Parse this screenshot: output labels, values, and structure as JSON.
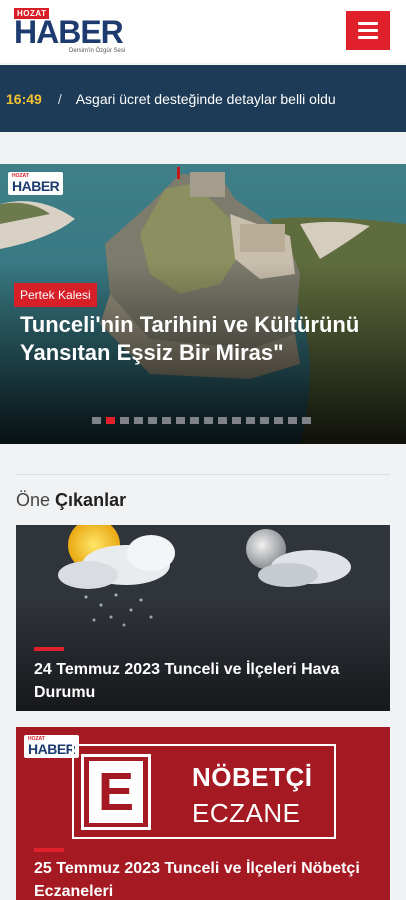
{
  "header": {
    "logo_top": "HOZAT",
    "logo_main": "HABER",
    "logo_slogan": "Dersim'in Özgür Sesi",
    "menu_icon": "hamburger-menu-icon"
  },
  "ticker": {
    "time": "16:49",
    "separator": "/",
    "headline": "Asgari ücret desteğinde detaylar belli oldu"
  },
  "slider": {
    "watermark_top": "HOZAT",
    "watermark_main": "HABER",
    "category": "Pertek Kalesi",
    "title": "Tunceli'nin Tarihini ve Kültürünü Yansıtan Eşsiz Bir Miras\"",
    "slide_count": 16,
    "active_slide": 2
  },
  "featured": {
    "section_title_light": "Öne",
    "section_title_bold": "Çıkanlar",
    "cards": [
      {
        "title": "24 Temmuz 2023 Tunceli ve İlçeleri Hava Durumu"
      },
      {
        "watermark_top": "HOZAT",
        "watermark_main": "HABER",
        "sign_letter": "E",
        "sign_line1": "NÖBETÇİ",
        "sign_line2": "ECZANE",
        "title": "25 Temmuz 2023 Tunceli ve İlçeleri Nöbetçi Eczaneleri"
      }
    ]
  },
  "colors": {
    "brand_red": "#e0202a",
    "brand_navy": "#1d3b6e",
    "ticker_bg": "#1d3a56",
    "ticker_time": "#f3c233"
  }
}
